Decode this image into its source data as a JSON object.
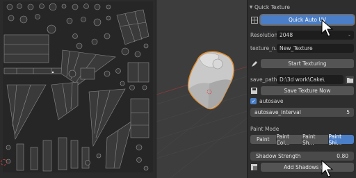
{
  "panel": {
    "title": "Quick Texture",
    "quick_auto_uv_label": "Quick Auto UV",
    "resolution_label": "Resolution:",
    "resolution_value": "2048",
    "texture_name_label": "texture_n...",
    "texture_name_value": "New_Texture",
    "start_texturing_label": "Start Texturing",
    "save_path_label": "save_path:",
    "save_path_value": "D:\\3d work\\Cake\\",
    "save_texture_label": "Save Texture Now",
    "autosave_label": "autosave",
    "autosave_checked": true,
    "autosave_interval_label": "autosave_interval",
    "autosave_interval_value": "5",
    "paint_mode_label": "Paint Mode",
    "paint_modes": [
      "Paint",
      "Paint Col...",
      "Paint Sh...",
      "Paint Shi..."
    ],
    "paint_mode_active_index": 3,
    "shadow_strength_label": "Shadow Strength",
    "shadow_strength_value": "0.80",
    "add_shadows_label": "Add Shadows (A..."
  },
  "colors": {
    "accent": "#4a7ec6",
    "button": "#545454",
    "field": "#1d1d1d",
    "cake_outline": "#e28a28"
  },
  "icons": [
    "chevron-down-icon",
    "uv-icon",
    "chevron-down-icon",
    "paint-icon",
    "folder-icon",
    "save-icon",
    "checkbox-icon",
    "cursor-icon"
  ]
}
